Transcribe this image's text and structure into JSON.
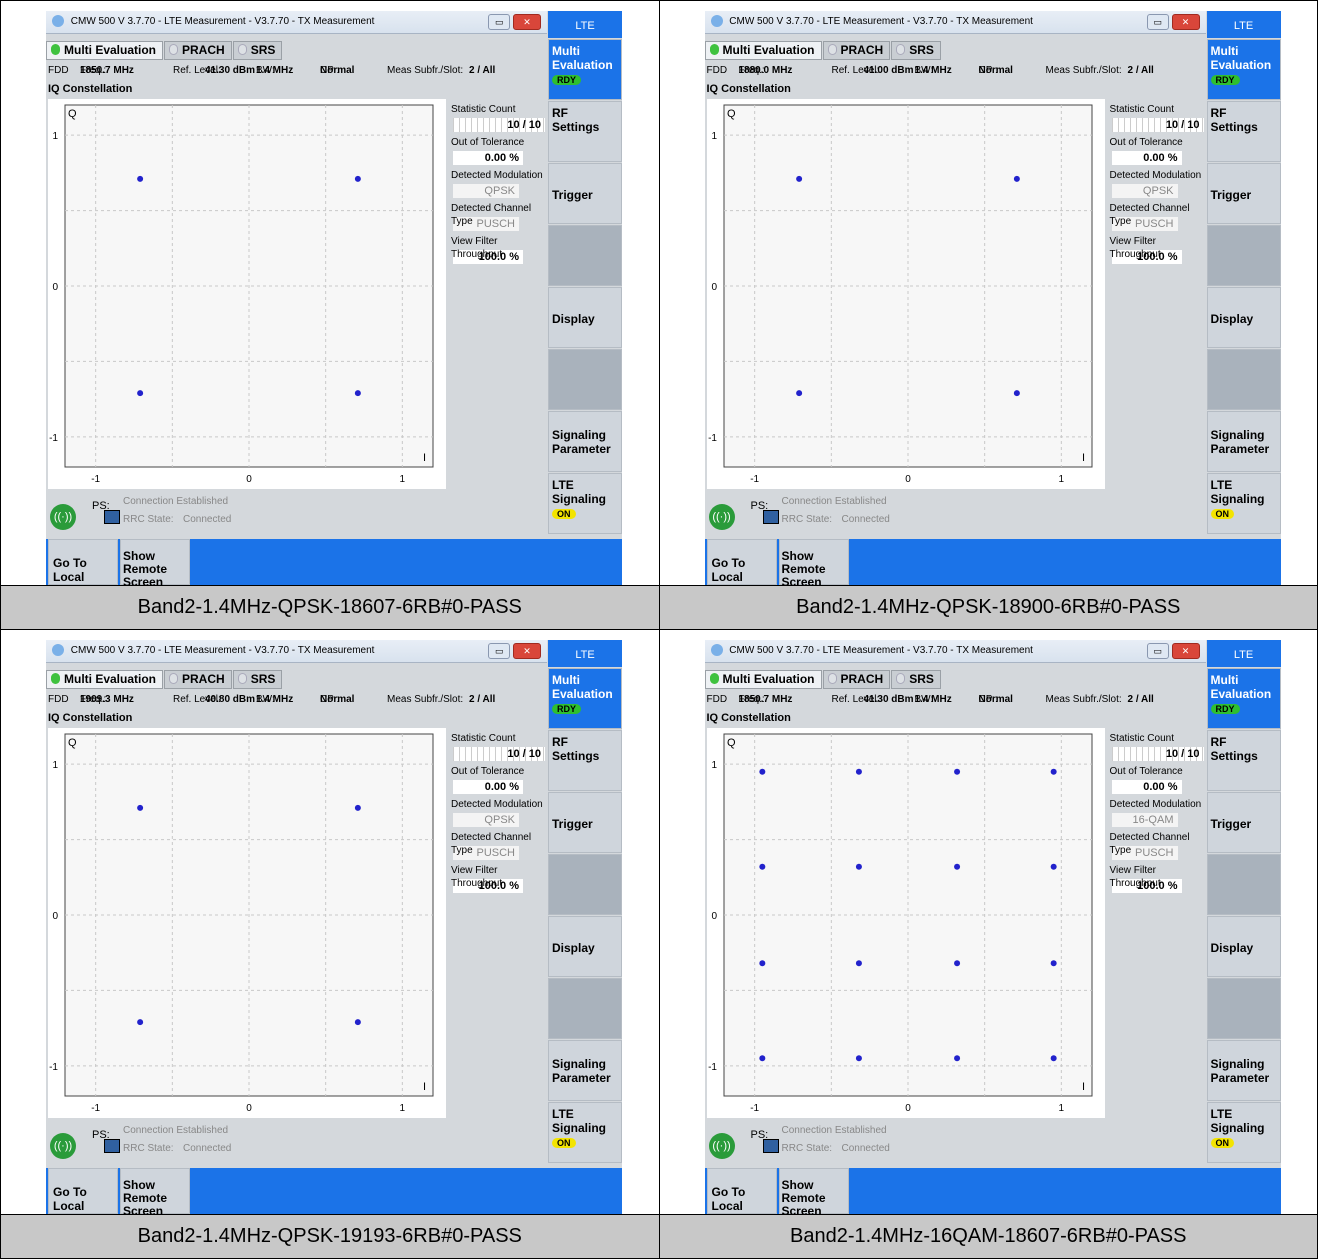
{
  "window": {
    "title": "CMW 500 V 3.7.70 - LTE Measurement  - V3.7.70 - TX Measurement",
    "lte_tab": "LTE",
    "minimize_symbol": "▭",
    "close_symbol": "✕"
  },
  "tabs": [
    "Multi Evaluation",
    "PRACH",
    "SRS"
  ],
  "info": {
    "duplex": "FDD",
    "freq_label": "Freq.:",
    "ref_level_label": "Ref. Level:",
    "bw_label": "BW:",
    "bw_value": "1.4 MHz",
    "cp_label": "CP :",
    "cp_value": "Normal",
    "meas_label": "Meas Subfr./Slot:",
    "meas_value": "2  / All"
  },
  "section_title": "IQ Constellation",
  "axis": {
    "q_label": "Q",
    "i_label": "I",
    "y_ticks": [
      "1",
      "0",
      "-1"
    ],
    "x_ticks": [
      "-1",
      "0",
      "1"
    ]
  },
  "stats_labels": {
    "statistic_count": "Statistic Count",
    "out_of_tolerance": "Out of Tolerance",
    "detected_modulation": "Detected Modulation",
    "detected_channel_type": "Detected Channel Type",
    "view_filter_throughput": "View Filter Throughput"
  },
  "softkeys": {
    "multi_evaluation": "Multi Evaluation",
    "rdy": "RDY",
    "rf_settings": "RF Settings",
    "trigger": "Trigger",
    "display": "Display",
    "signaling_parameter": "Signaling Parameter",
    "lte_signaling": "LTE Signaling",
    "on": "ON"
  },
  "status": {
    "ps": "PS:",
    "connection": "Connection Established",
    "rrc_label": "RRC State:",
    "rrc_value": "Connected"
  },
  "bottom": {
    "go_to_local": "Go To Local",
    "show_remote": "Show Remote Screen"
  },
  "screens": [
    {
      "freq": "1850.7 MHz",
      "ref_level": "41.30 dBm",
      "statistic_count": "10 / 10",
      "out_of_tolerance": "0.00  %",
      "detected_modulation": "QPSK",
      "detected_channel_type": "PUSCH",
      "view_filter_throughput": "100.0  %",
      "caption": "Band2-1.4MHz-QPSK-18607-6RB#0-PASS",
      "constellation": {
        "type": "scatter",
        "modulation": "QPSK",
        "xlim": [
          -1.2,
          1.2
        ],
        "ylim": [
          -1.2,
          1.2
        ],
        "points": [
          [
            -0.71,
            0.71
          ],
          [
            0.71,
            0.71
          ],
          [
            -0.71,
            -0.71
          ],
          [
            0.71,
            -0.71
          ]
        ]
      }
    },
    {
      "freq": "1880.0 MHz",
      "ref_level": "41.00 dBm",
      "statistic_count": "10 / 10",
      "out_of_tolerance": "0.00  %",
      "detected_modulation": "QPSK",
      "detected_channel_type": "PUSCH",
      "view_filter_throughput": "100.0  %",
      "caption": "Band2-1.4MHz-QPSK-18900-6RB#0-PASS",
      "constellation": {
        "type": "scatter",
        "modulation": "QPSK",
        "xlim": [
          -1.2,
          1.2
        ],
        "ylim": [
          -1.2,
          1.2
        ],
        "points": [
          [
            -0.71,
            0.71
          ],
          [
            0.71,
            0.71
          ],
          [
            -0.71,
            -0.71
          ],
          [
            0.71,
            -0.71
          ]
        ]
      }
    },
    {
      "freq": "1909.3 MHz",
      "ref_level": "40.80 dBm",
      "statistic_count": "10 / 10",
      "out_of_tolerance": "0.00  %",
      "detected_modulation": "QPSK",
      "detected_channel_type": "PUSCH",
      "view_filter_throughput": "100.0  %",
      "caption": "Band2-1.4MHz-QPSK-19193-6RB#0-PASS",
      "constellation": {
        "type": "scatter",
        "modulation": "QPSK",
        "xlim": [
          -1.2,
          1.2
        ],
        "ylim": [
          -1.2,
          1.2
        ],
        "points": [
          [
            -0.71,
            0.71
          ],
          [
            0.71,
            0.71
          ],
          [
            -0.71,
            -0.71
          ],
          [
            0.71,
            -0.71
          ]
        ]
      }
    },
    {
      "freq": "1850.7 MHz",
      "ref_level": "41.30 dBm",
      "statistic_count": "10 / 10",
      "out_of_tolerance": "0.00  %",
      "detected_modulation": "16-QAM",
      "detected_channel_type": "PUSCH",
      "view_filter_throughput": "100.0  %",
      "caption": "Band2-1.4MHz-16QAM-18607-6RB#0-PASS",
      "constellation": {
        "type": "scatter",
        "modulation": "16-QAM",
        "xlim": [
          -1.2,
          1.2
        ],
        "ylim": [
          -1.2,
          1.2
        ],
        "points": [
          [
            -0.95,
            0.95
          ],
          [
            -0.32,
            0.95
          ],
          [
            0.32,
            0.95
          ],
          [
            0.95,
            0.95
          ],
          [
            -0.95,
            0.32
          ],
          [
            -0.32,
            0.32
          ],
          [
            0.32,
            0.32
          ],
          [
            0.95,
            0.32
          ],
          [
            -0.95,
            -0.32
          ],
          [
            -0.32,
            -0.32
          ],
          [
            0.32,
            -0.32
          ],
          [
            0.95,
            -0.32
          ],
          [
            -0.95,
            -0.95
          ],
          [
            -0.32,
            -0.95
          ],
          [
            0.32,
            -0.95
          ],
          [
            0.95,
            -0.95
          ]
        ]
      }
    }
  ],
  "colors": {
    "accent_blue": "#1b73e8",
    "constellation_point": "#2222cc",
    "rdy": "#2fbf2f",
    "on": "#f3e400",
    "caption_bg": "#c8c8c8"
  }
}
